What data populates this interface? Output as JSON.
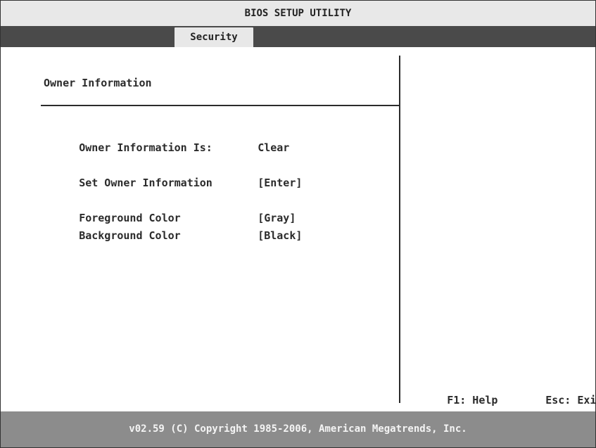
{
  "window": {
    "title": "BIOS SETUP UTILITY"
  },
  "tabs": [
    {
      "label": "Security",
      "active": true
    }
  ],
  "section": {
    "title": "Owner Information"
  },
  "settings": [
    {
      "label": "Owner Information Is:",
      "value": "Clear"
    },
    {
      "label": "Set Owner Information",
      "value": "[Enter]"
    },
    {
      "label": "Foreground Color",
      "value": "[Gray]"
    },
    {
      "label": "Background Color",
      "value": "[Black]"
    }
  ],
  "help_keys": [
    {
      "label": "F1: Help"
    },
    {
      "label": "Esc: Exit"
    }
  ],
  "footer": {
    "text": "v02.59 (C) Copyright 1985-2006, American Megatrends, Inc."
  },
  "colors": {
    "title_bg": "#e8e8e8",
    "tabbar_bg": "#4a4a4a",
    "footer_bg": "#8c8c8c",
    "text": "#2b2b2b"
  }
}
